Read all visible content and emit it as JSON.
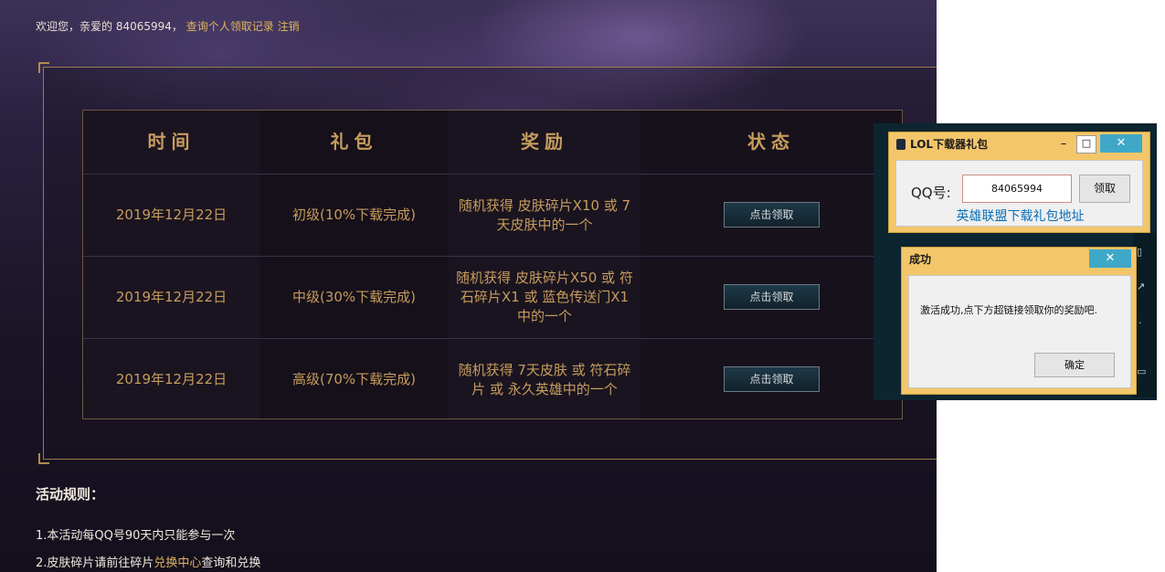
{
  "header": {
    "welcome_prefix": "欢迎您，亲爱的 84065994，",
    "records_link": "查询个人领取记录",
    "logout_link": "注销"
  },
  "table": {
    "headers": [
      "时间",
      "礼包",
      "奖励",
      "状态"
    ],
    "rows": [
      {
        "date": "2019年12月22日",
        "pack": "初级(10%下载完成)",
        "reward": "随机获得 皮肤碎片X10 或 7天皮肤中的一个",
        "button": "点击领取"
      },
      {
        "date": "2019年12月22日",
        "pack": "中级(30%下载完成)",
        "reward": "随机获得 皮肤碎片X50 或 符石碎片X1 或 蓝色传送门X1中的一个",
        "button": "点击领取"
      },
      {
        "date": "2019年12月22日",
        "pack": "高级(70%下载完成)",
        "reward": "随机获得 7天皮肤 或 符石碎片 或 永久英雄中的一个",
        "button": "点击领取"
      }
    ]
  },
  "rules": {
    "title": "活动规则：",
    "rule1": "1.本活动每QQ号90天内只能参与一次",
    "rule2_prefix": "2.皮肤碎片请前往碎片",
    "rule2_link": "兑换中心",
    "rule2_suffix": "查询和兑换"
  },
  "gift_dialog": {
    "title": "LOL下载器礼包",
    "qq_label": "QQ号:",
    "qq_value": "84065994",
    "claim_button": "领取",
    "link": "英雄联盟下载礼包地址",
    "minimize": "–",
    "maximize": "□",
    "close": "✕"
  },
  "success_dialog": {
    "title": "成功",
    "message": "激活成功,点下方超链接领取你的奖励吧.",
    "ok_button": "确定",
    "close": "✕"
  },
  "colors": {
    "gold": "#c69c5d",
    "dialog_frame": "#f3c66a",
    "close_button": "#3fa8c9",
    "link_blue": "#0b6fb7"
  },
  "icons": [
    "app-icon",
    "minimize-icon",
    "maximize-icon",
    "close-icon"
  ]
}
